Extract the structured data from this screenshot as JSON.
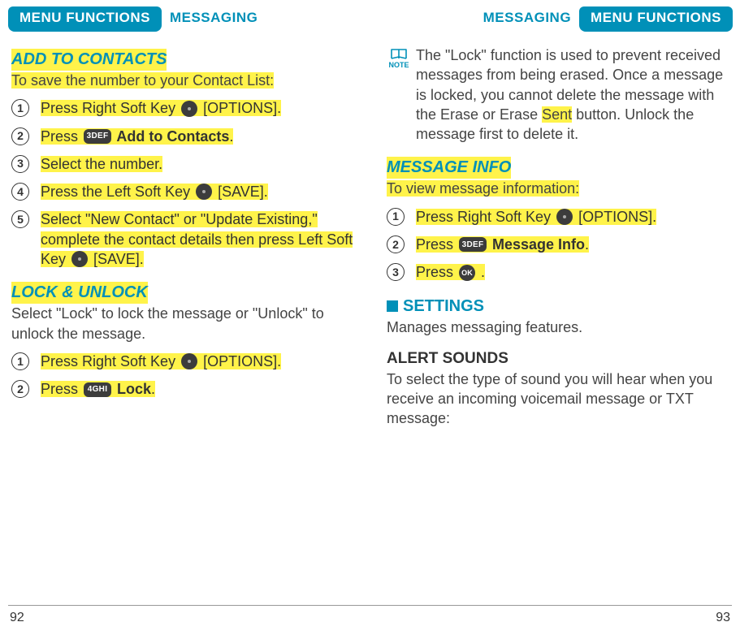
{
  "header": {
    "left_pill": "MENU FUNCTIONS",
    "left_side": "MESSAGING",
    "right_side": "MESSAGING",
    "right_pill": "MENU FUNCTIONS"
  },
  "left": {
    "add": {
      "title": "ADD TO CONTACTS",
      "desc": "To save the number to your Contact List:",
      "steps": [
        {
          "pre": "Press Right Soft Key ",
          "key": "dot",
          "post": " [OPTIONS]."
        },
        {
          "pre": "Press ",
          "key": "3DEF",
          "post_bold": " Add to Contacts",
          "tail": "."
        },
        {
          "pre": "Select the number."
        },
        {
          "pre": "Press the Left Soft Key ",
          "key": "dot",
          "post": " [SAVE]."
        },
        {
          "pre": "Select \"New Contact\" or \"Update Existing,\" complete the contact details then press Left Soft Key ",
          "key": "dot",
          "post": " [SAVE]."
        }
      ]
    },
    "lock": {
      "title": "LOCK & UNLOCK",
      "desc": "Select \"Lock\" to lock the message or \"Unlock\" to unlock the message.",
      "steps": [
        {
          "pre": "Press Right Soft Key ",
          "key": "dot",
          "post": " [OPTIONS]."
        },
        {
          "pre": "Press ",
          "key": "4GHI",
          "post_bold": " Lock",
          "tail": "."
        }
      ]
    }
  },
  "right": {
    "note_label": "NOTE",
    "note": {
      "p1": "The \"Lock\" function is used to prevent received messages from being erased. Once a message is locked, you cannot delete the message with the Erase or Erase ",
      "hl": "Sent",
      "p2": " button. Unlock the message first to delete it."
    },
    "info": {
      "title": "MESSAGE INFO",
      "desc": "To view message information:",
      "steps": [
        {
          "pre": "Press Right Soft Key ",
          "key": "dot",
          "post": " [OPTIONS]."
        },
        {
          "pre": "Press ",
          "key": "3DEF",
          "post_bold": " Message Info",
          "tail": "."
        },
        {
          "pre": "Press ",
          "key": "OK",
          "post": " ."
        }
      ]
    },
    "settings": {
      "title": "SETTINGS",
      "desc": "Manages messaging features.",
      "alert_heading": "ALERT SOUNDS",
      "alert_desc": "To select the type of sound you will hear when you receive an incoming voicemail message or TXT message:"
    }
  },
  "footer": {
    "left_page": "92",
    "right_page": "93"
  }
}
